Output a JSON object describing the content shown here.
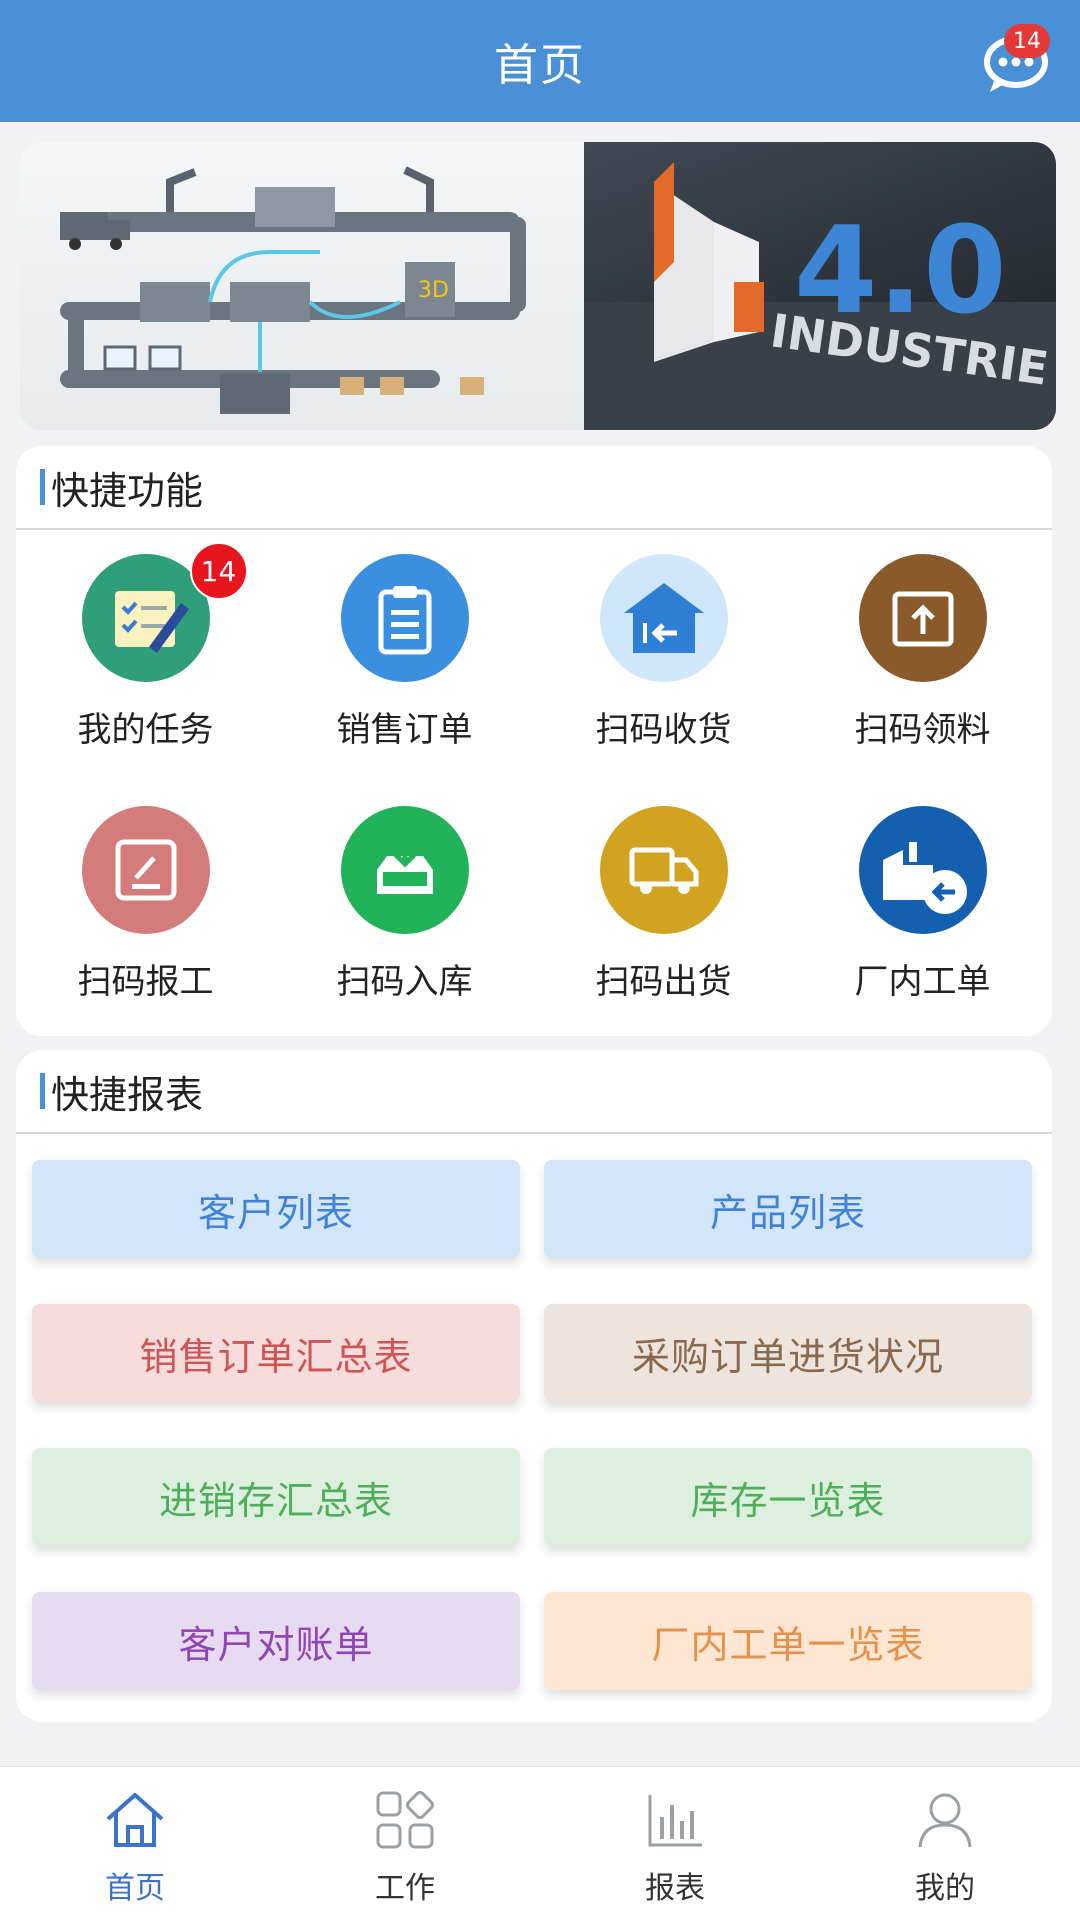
{
  "header": {
    "title": "首页",
    "message_badge": "14"
  },
  "banner": {
    "left_image": "factory-automation-illustration",
    "right_image": "industrie-4-0-photo",
    "right_text": "4.0",
    "right_caption": "INDUSTRIE"
  },
  "quick_functions": {
    "title": "快捷功能",
    "items": [
      {
        "label": "我的任务",
        "icon": "task-list-icon",
        "color": "#2f9e7a",
        "badge": "14"
      },
      {
        "label": "销售订单",
        "icon": "clipboard-icon",
        "color": "#3a8fe0"
      },
      {
        "label": "扫码收货",
        "icon": "warehouse-receive-icon",
        "color": "#cfe6fb"
      },
      {
        "label": "扫码领料",
        "icon": "box-upload-icon",
        "color": "#8a5a2b"
      },
      {
        "label": "扫码报工",
        "icon": "report-edit-icon",
        "color": "#d47b7b"
      },
      {
        "label": "扫码入库",
        "icon": "inbox-download-icon",
        "color": "#22b25a"
      },
      {
        "label": "扫码出货",
        "icon": "truck-icon",
        "color": "#d1a321"
      },
      {
        "label": "厂内工单",
        "icon": "factory-return-icon",
        "color": "#155fb0"
      }
    ]
  },
  "quick_reports": {
    "title": "快捷报表",
    "items": [
      {
        "label": "客户列表",
        "bg": "#d4e6fb",
        "fg": "#3f82d8"
      },
      {
        "label": "产品列表",
        "bg": "#d4e6fb",
        "fg": "#3f82d8"
      },
      {
        "label": "销售订单汇总表",
        "bg": "#f7dcdc",
        "fg": "#cf5555"
      },
      {
        "label": "采购订单进货状况",
        "bg": "#eee4de",
        "fg": "#8a6a4e"
      },
      {
        "label": "进销存汇总表",
        "bg": "#ddf0df",
        "fg": "#4fae5a"
      },
      {
        "label": "库存一览表",
        "bg": "#ddf0df",
        "fg": "#4fae5a"
      },
      {
        "label": "客户对账单",
        "bg": "#e7dbf1",
        "fg": "#9146b5"
      },
      {
        "label": "厂内工单一览表",
        "bg": "#fde7d3",
        "fg": "#e6904a"
      }
    ]
  },
  "tabbar": {
    "items": [
      {
        "label": "首页",
        "icon": "home-icon",
        "active": true
      },
      {
        "label": "工作",
        "icon": "grid-apps-icon",
        "active": false
      },
      {
        "label": "报表",
        "icon": "bar-chart-icon",
        "active": false
      },
      {
        "label": "我的",
        "icon": "user-icon",
        "active": false
      }
    ]
  }
}
